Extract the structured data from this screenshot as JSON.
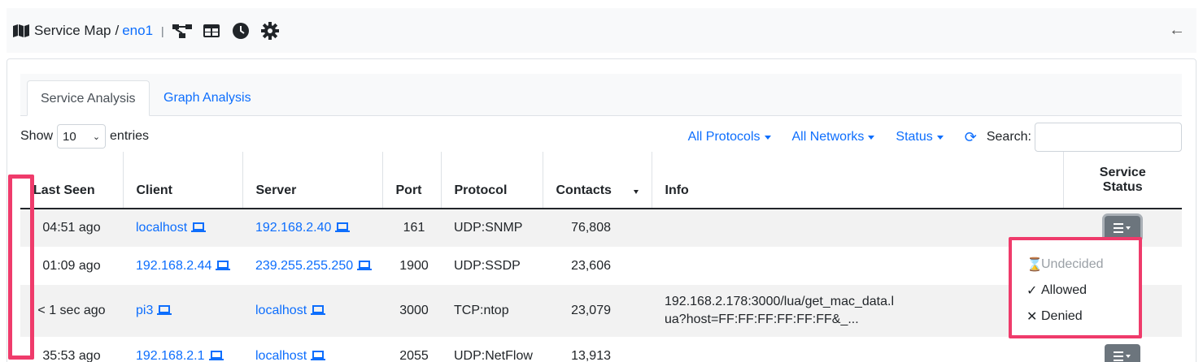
{
  "header": {
    "title": "Service Map",
    "separator": "/",
    "interface": "eno1",
    "pipe": "|",
    "icons": [
      "network-icon",
      "table-icon",
      "clock-icon",
      "gear-icon"
    ],
    "back_icon": "arrow-left-icon"
  },
  "tabs": [
    {
      "label": "Service Analysis",
      "active": true
    },
    {
      "label": "Graph Analysis",
      "active": false
    }
  ],
  "controls": {
    "show_label": "Show",
    "entries_value": "10",
    "entries_label": "entries",
    "filters": [
      "All Protocols",
      "All Networks",
      "Status"
    ],
    "search_label": "Search:",
    "search_value": ""
  },
  "table": {
    "columns": [
      "Last Seen",
      "Client",
      "Server",
      "Port",
      "Protocol",
      "Contacts",
      "Info",
      "Service Status"
    ],
    "rows": [
      {
        "last_seen": "04:51 ago",
        "client": "localhost",
        "server": "192.168.2.40",
        "port": "161",
        "protocol": "UDP:SNMP",
        "contacts": "76,808",
        "info": ""
      },
      {
        "last_seen": "01:09 ago",
        "client": "192.168.2.44",
        "server": "239.255.255.250",
        "port": "1900",
        "protocol": "UDP:SSDP",
        "contacts": "23,606",
        "info": ""
      },
      {
        "last_seen": "< 1 sec ago",
        "client": "pi3",
        "server": "localhost",
        "port": "3000",
        "protocol": "TCP:ntop",
        "contacts": "23,079",
        "info": "192.168.2.178:3000/lua/get_mac_data.lua?host=FF:FF:FF:FF:FF:FF&_..."
      },
      {
        "last_seen": "35:53 ago",
        "client": "192.168.2.1",
        "server": "localhost",
        "port": "2055",
        "protocol": "UDP:NetFlow",
        "contacts": "13,913",
        "info": ""
      }
    ]
  },
  "status_menu": {
    "items": [
      {
        "label": "Undecided",
        "icon": "hourglass-icon",
        "disabled": true
      },
      {
        "label": "Allowed",
        "icon": "check-icon",
        "disabled": false
      },
      {
        "label": "Denied",
        "icon": "x-icon",
        "disabled": false
      }
    ]
  },
  "colors": {
    "link": "#0d6efd",
    "highlight": "#ef3b6b",
    "button": "#6c757d"
  }
}
